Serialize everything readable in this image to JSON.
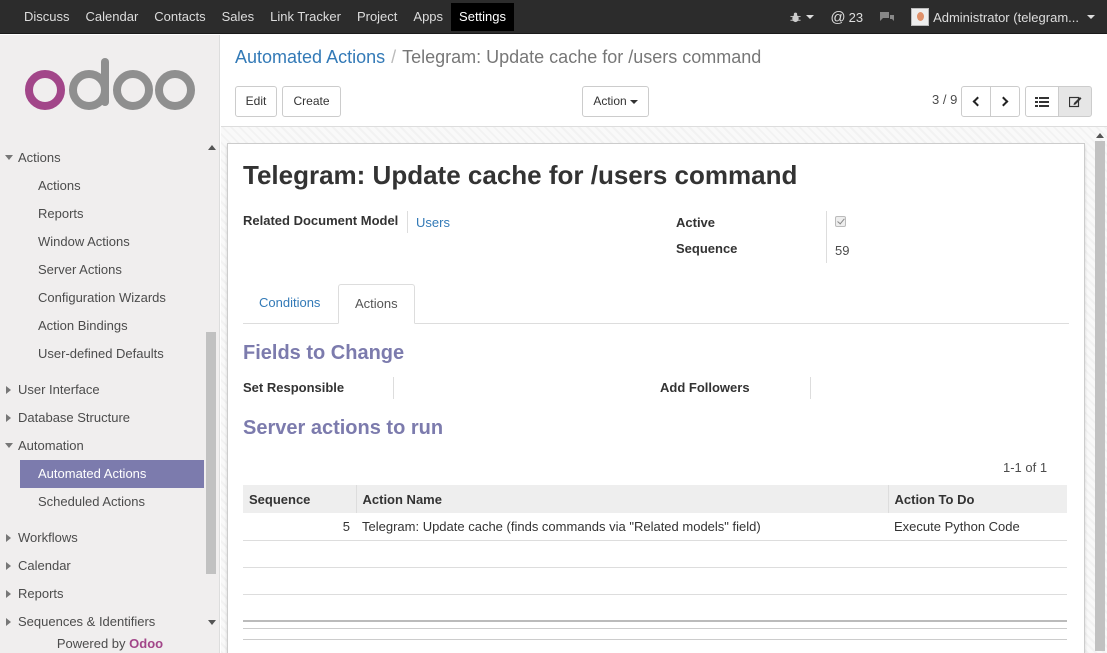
{
  "topbar": {
    "menu": [
      "Discuss",
      "Calendar",
      "Contacts",
      "Sales",
      "Link Tracker",
      "Project",
      "Apps",
      "Settings"
    ],
    "active_menu": "Settings",
    "messages_count": "23",
    "user": "Administrator (telegram..."
  },
  "sidebar": {
    "logo": "odoo",
    "actions_section": "Actions",
    "actions_items": [
      "Actions",
      "Reports",
      "Window Actions",
      "Server Actions",
      "Configuration Wizards",
      "Action Bindings",
      "User-defined Defaults"
    ],
    "user_interface": "User Interface",
    "database_structure": "Database Structure",
    "automation": "Automation",
    "automation_items": [
      "Automated Actions",
      "Scheduled Actions"
    ],
    "workflows": "Workflows",
    "calendar": "Calendar",
    "reports": "Reports",
    "sequences": "Sequences & Identifiers",
    "powered_by": "Powered by",
    "powered_brand": "Odoo"
  },
  "control": {
    "breadcrumb_parent": "Automated Actions",
    "breadcrumb_current": "Telegram: Update cache for /users command",
    "edit_label": "Edit",
    "create_label": "Create",
    "action_label": "Action",
    "pager": "3 / 9"
  },
  "form": {
    "title": "Telegram: Update cache for /users command",
    "related_model_label": "Related Document Model",
    "related_model_value": "Users",
    "active_label": "Active",
    "active_value": true,
    "sequence_label": "Sequence",
    "sequence_value": "59",
    "tabs": [
      "Conditions",
      "Actions"
    ],
    "active_tab": "Actions",
    "fields_to_change": "Fields to Change",
    "set_responsible_label": "Set Responsible",
    "add_followers_label": "Add Followers",
    "server_actions_title": "Server actions to run",
    "list_pager": "1-1 of 1",
    "columns": [
      "Sequence",
      "Action Name",
      "Action To Do"
    ],
    "rows": [
      {
        "sequence": "5",
        "name": "Telegram: Update cache (finds commands via \"Related models\" field)",
        "action": "Execute Python Code"
      }
    ]
  }
}
